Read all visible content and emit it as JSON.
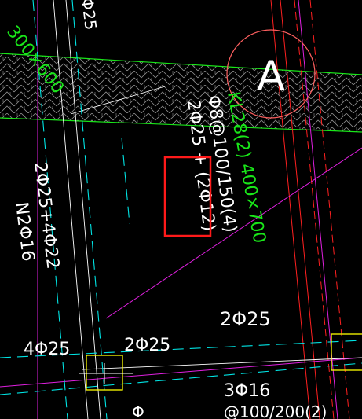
{
  "drawing": {
    "background": "#000000",
    "colors": {
      "text": "#ffffff",
      "green": "#19e619",
      "cyan": "#00e5e5",
      "red": "#ff2020",
      "magenta": "#e020e0",
      "yellow": "#ffff00",
      "axis_circle": "#ff6060",
      "hatch": "#b4b4b4",
      "highlight_box": "#ff1a1a"
    },
    "axis_label": "A",
    "beam_label_green": "KL28(2) 400×700",
    "wall_label_green": "300×600",
    "stirrup_spec": "Φ8@100/150(4)",
    "top_bars": "2Φ25 + (2Φ12)",
    "highlighted_text": "(2Φ12)",
    "left_beam_bars": "2Φ25+4Φ22",
    "left_beam_side": "N2Φ16",
    "top_left_fragment": "Φ25",
    "bottom_span_top_bars": "2Φ25",
    "left_support_bars": "4Φ25",
    "right_support_bars": "2Φ25",
    "bottom_bars": "3Φ16",
    "bottom_fragment": "Φ",
    "bottom_right_fragment": "@100/200(2)"
  }
}
